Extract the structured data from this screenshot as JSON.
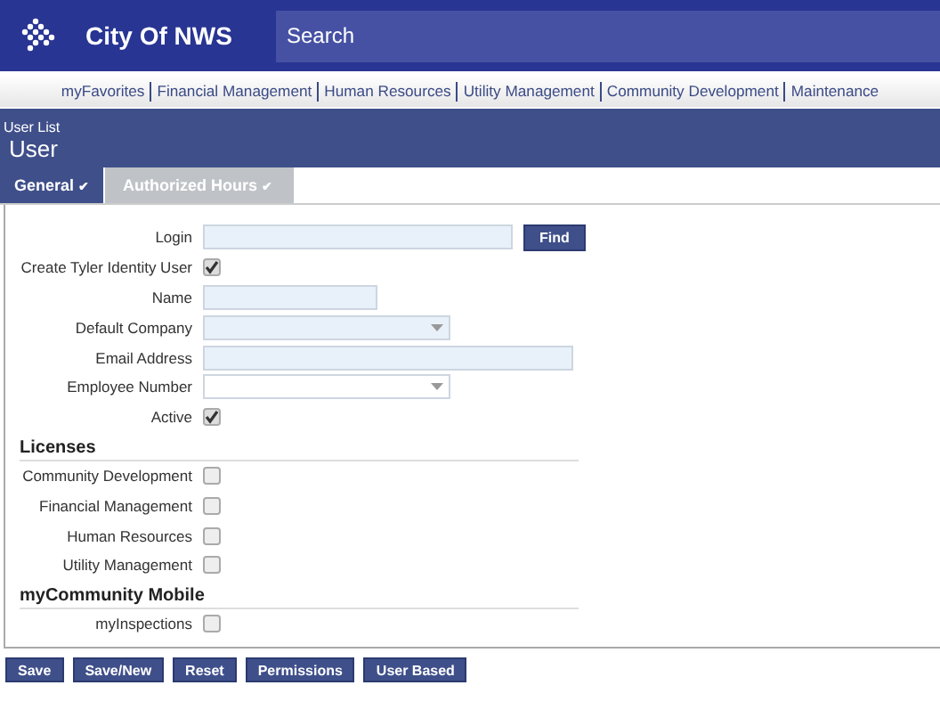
{
  "header": {
    "title": "City Of NWS",
    "search": {
      "placeholder": "Search"
    }
  },
  "nav": [
    "myFavorites",
    "Financial Management",
    "Human Resources",
    "Utility Management",
    "Community Development",
    "Maintenance"
  ],
  "page": {
    "breadcrumb": "User List",
    "title": "User"
  },
  "tabs": [
    {
      "label": "General",
      "check": "✔",
      "selected": true
    },
    {
      "label": "Authorized Hours",
      "check": "✔",
      "selected": false
    }
  ],
  "fields": [
    {
      "kind": "text",
      "label": "Login",
      "button": "Find"
    },
    {
      "kind": "checkbox",
      "label": "Create Tyler Identity User",
      "checked": true
    },
    {
      "kind": "text",
      "label": "Name"
    },
    {
      "kind": "select",
      "label": "Default Company",
      "disabled": true
    },
    {
      "kind": "text",
      "label": "Email Address"
    },
    {
      "kind": "select",
      "label": "Employee Number",
      "disabled": false
    },
    {
      "kind": "checkbox",
      "label": "Active",
      "checked": true
    }
  ],
  "sections": [
    {
      "title": "Licenses",
      "items": [
        {
          "label": "Community Development",
          "checked": false
        },
        {
          "label": "Financial Management",
          "checked": false
        },
        {
          "label": "Human Resources",
          "checked": false
        },
        {
          "label": "Utility Management",
          "checked": false
        }
      ]
    },
    {
      "title": "myCommunity Mobile",
      "items": [
        {
          "label": "myInspections",
          "checked": false
        }
      ]
    }
  ],
  "buttons": [
    "Save",
    "Save/New",
    "Reset",
    "Permissions",
    "User Based"
  ]
}
